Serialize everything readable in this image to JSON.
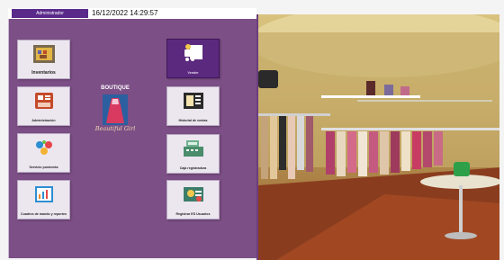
{
  "header": {
    "user_role": "Administrador",
    "datetime": "16/12/2022 14:29:57"
  },
  "menu_left": [
    {
      "label": "Inventarios",
      "icon": "inventory-icon"
    },
    {
      "label": "Administración",
      "icon": "cash-drawer-icon"
    },
    {
      "label": "Servicio postventa",
      "icon": "customer-service-icon"
    },
    {
      "label": "Cuadros de mando y reportes",
      "icon": "dashboard-report-icon"
    }
  ],
  "menu_right": [
    {
      "label": "Vender",
      "icon": "shopping-cart-icon",
      "active": true
    },
    {
      "label": "Historial de ventas",
      "icon": "sales-history-icon"
    },
    {
      "label": "Caja registradora",
      "icon": "cash-register-icon"
    },
    {
      "label": "Registrar ES Usuarios",
      "icon": "register-user-icon"
    }
  ],
  "logo": {
    "top_text": "BOUTIQUE",
    "script_text": "Beautiful Girl"
  },
  "colors": {
    "panel": "#7c4f86",
    "accent": "#5b2a7e",
    "badge": "#5a2a8a"
  }
}
